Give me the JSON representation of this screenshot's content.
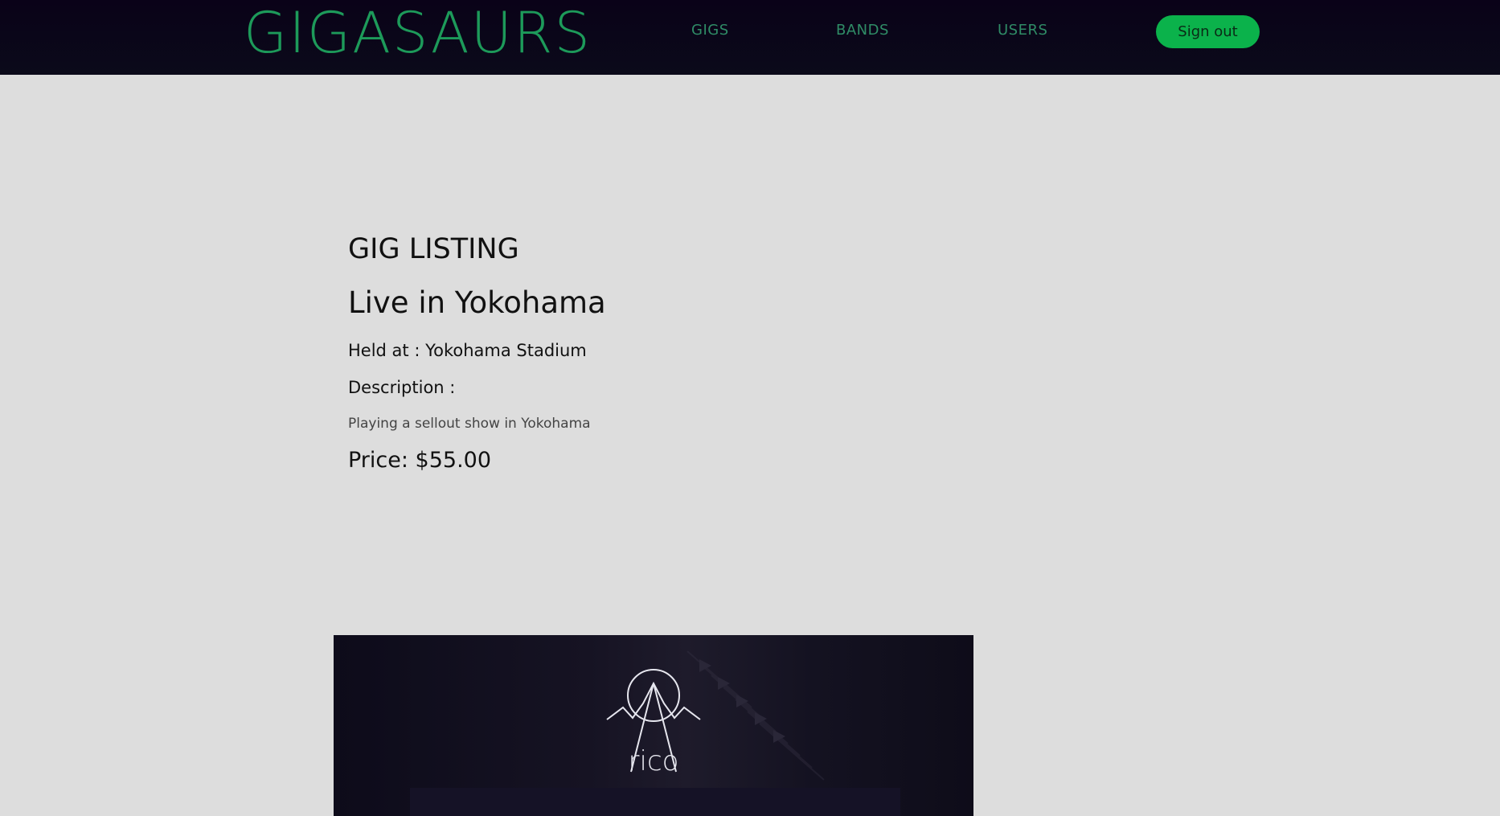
{
  "nav": {
    "brand": "GIGASAURS",
    "links": [
      "GIGS",
      "BANDS",
      "USERS"
    ],
    "signout_label": "Sign out",
    "accent_color": "#0bb24b",
    "brand_color": "#1d9a5a"
  },
  "gig": {
    "section_heading": "GIG LISTING",
    "title": "Live in Yokohama",
    "venue_line": "Held at : Yokohama Stadium",
    "description_label": "Description :",
    "description": "Playing a sellout show in Yokohama",
    "price_line": "Price: $55.00"
  },
  "band_image": {
    "logo_text": "rico",
    "icon": "band-logo-mountain-circle"
  }
}
